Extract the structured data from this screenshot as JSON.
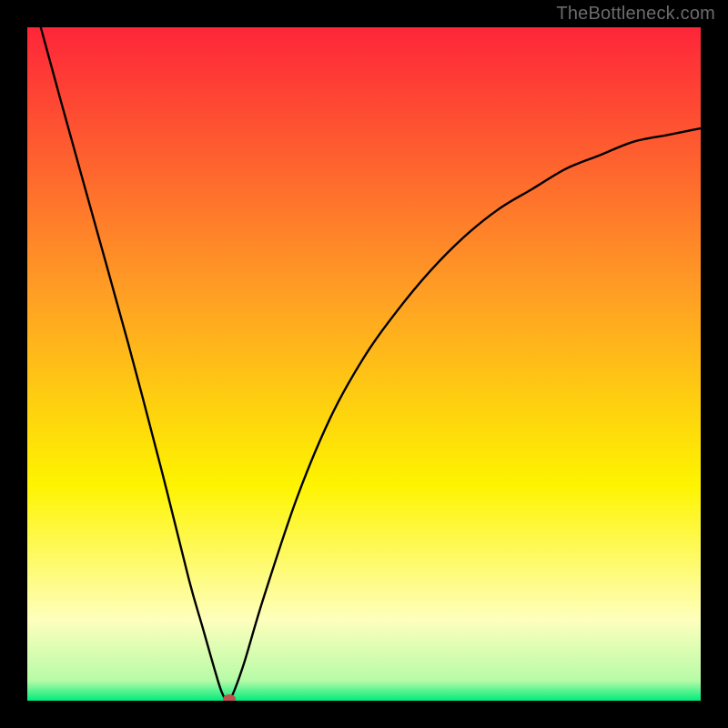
{
  "watermark": "TheBottleneck.com",
  "chart_data": {
    "type": "line",
    "title": "",
    "xlabel": "",
    "ylabel": "",
    "xlim": [
      0,
      100
    ],
    "ylim": [
      0,
      100
    ],
    "grid": false,
    "series": [
      {
        "name": "curve",
        "x": [
          2,
          5,
          10,
          15,
          20,
          24,
          26,
          28,
          29,
          30,
          32,
          35,
          40,
          45,
          50,
          55,
          60,
          65,
          70,
          75,
          80,
          85,
          90,
          95,
          100
        ],
        "y": [
          100,
          89,
          71,
          53,
          34,
          18,
          11,
          4,
          1,
          0,
          5,
          15,
          30,
          42,
          51,
          58,
          64,
          69,
          73,
          76,
          79,
          81,
          83,
          84,
          85
        ]
      }
    ],
    "marker": {
      "x": 30,
      "y": 0,
      "color": "#c0534f"
    },
    "background_gradient": {
      "top": "#fe2539",
      "mid": "#fef400",
      "bottom": "#00ec7c"
    }
  }
}
